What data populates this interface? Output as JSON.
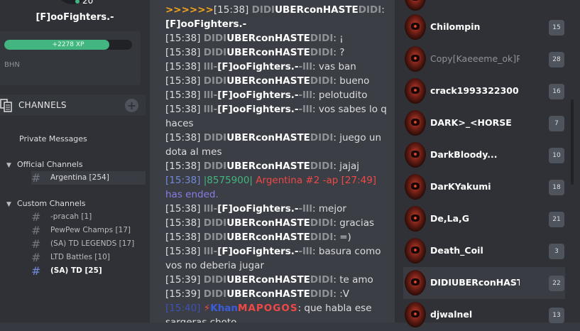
{
  "user": {
    "xp_small": "20",
    "name": "[F]ooFighters.-",
    "xp_label": "+2278 XP",
    "xp_progress": 0.82,
    "server_tag": "BHN"
  },
  "channels": {
    "title": "CHANNELS",
    "private_messages": "Private Messages",
    "official_label": "Official Channels",
    "official": [
      {
        "name": "Argentina [254]"
      }
    ],
    "custom_label": "Custom Channels",
    "custom": [
      {
        "name": "-pracah [1]"
      },
      {
        "name": "PewPew Champs [17]"
      },
      {
        "name": "(SA) TD LEGENDS [17]"
      },
      {
        "name": "LTD Battles [10]"
      },
      {
        "name": "(SA) TD [25]"
      }
    ]
  },
  "chat": {
    "l1_arrows": ">>>>>>",
    "l1_ts": "[15:38]",
    "l1_user": "DIDIUBERconHASTEDIDI:",
    "l2": "[F]ooFighters.-",
    "u_didi_a": "DIDI",
    "u_didi_b": "UBERconHASTE",
    "u_didi_c": "DIDI",
    "u_foo_a": "lll-",
    "u_foo_b": "[F]ooFighters.-",
    "u_foo_c": "-lll",
    "ts1538": "[15:38]",
    "ts1539": "[15:39]",
    "m_excl": ": ¡",
    "m_q": ": ?",
    "m_vasban": ": vas ban",
    "m_bueno": ": bueno",
    "m_pelo": ": pelotudito",
    "m_vos1": ": vos sabes lo q",
    "m_vos2": "haces",
    "m_juego1": ": juego un",
    "m_juego2": "dota al mes",
    "m_jajaj": ": jajaj",
    "sys_ts": "[15:38]",
    "sys_id": "|8575900|",
    "sys_game": "Argentina #2 -ap [27:49]",
    "sys_end": "has ended.",
    "m_mejor": ": mejor",
    "m_gracias": ": gracias",
    "m_smile": ": =)",
    "m_basura1": ": basura como",
    "m_basura2": "vos no deberia jugar",
    "m_teamo": ": te amo",
    "m_v": ": :V",
    "last_ts": "[15:40]",
    "last_bolt": "⚡",
    "last_khan": "Khan",
    "last_brand": "MAPOGOS",
    "last_msg": ": que habla ese",
    "last_msg2": "sargeras choto"
  },
  "users": [
    {
      "name": "",
      "level": ""
    },
    {
      "name": "Chilompin",
      "level": "15"
    },
    {
      "name": "Copy[Kaeeeme_ok]P·",
      "level": "28"
    },
    {
      "name": "crack1993322300",
      "level": "16"
    },
    {
      "name": "DARK>_<HORSE",
      "level": "7"
    },
    {
      "name": "DarkBloody...",
      "level": "10"
    },
    {
      "name": "DarKYakumi",
      "level": "18"
    },
    {
      "name": "De,La,G",
      "level": "21"
    },
    {
      "name": "Death_Coil",
      "level": "3"
    },
    {
      "name": "DIDIUBERconHASTED",
      "level": "22"
    },
    {
      "name": "djwalnel",
      "level": "13"
    }
  ]
}
